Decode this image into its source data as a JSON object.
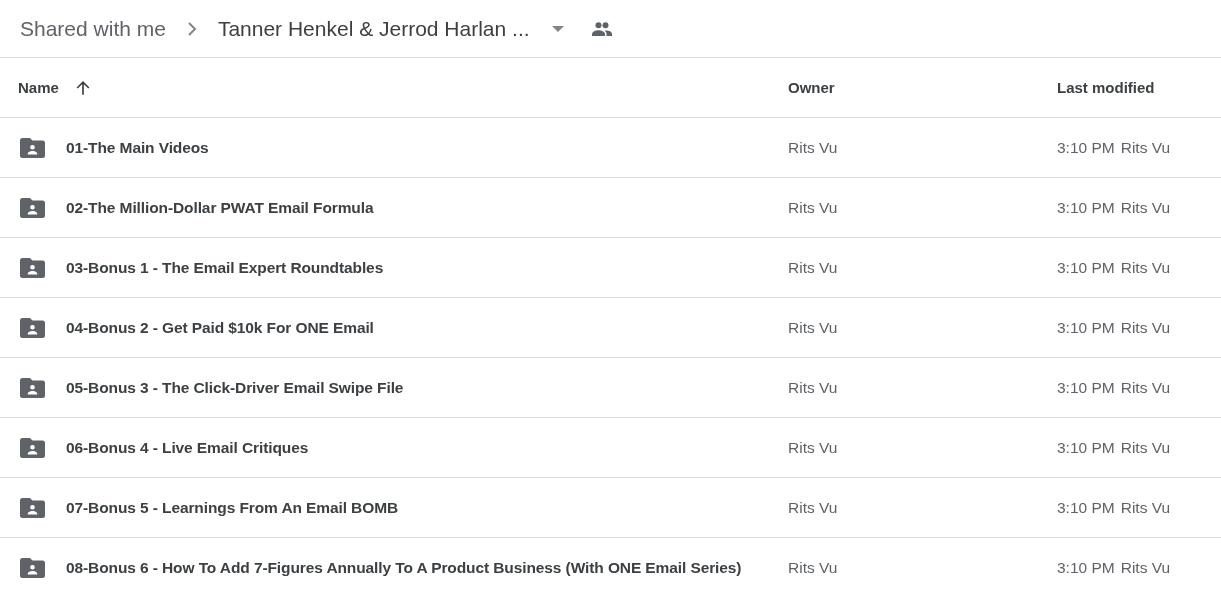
{
  "breadcrumb": [
    {
      "label": "Shared with me",
      "current": false
    },
    {
      "label": "Tanner Henkel & Jerrod Harlan ...",
      "current": true
    }
  ],
  "table": {
    "columns": [
      {
        "label": "Name",
        "sorted": true
      },
      {
        "label": "Owner"
      },
      {
        "label": "Last modified"
      }
    ],
    "rows": [
      {
        "name": "01-The Main Videos",
        "owner": "Rits Vu",
        "modified_time": "3:10 PM",
        "modified_by": "Rits Vu"
      },
      {
        "name": "02-The Million-Dollar PWAT Email Formula",
        "owner": "Rits Vu",
        "modified_time": "3:10 PM",
        "modified_by": "Rits Vu"
      },
      {
        "name": "03-Bonus 1 - The Email Expert Roundtables",
        "owner": "Rits Vu",
        "modified_time": "3:10 PM",
        "modified_by": "Rits Vu"
      },
      {
        "name": "04-Bonus 2 - Get Paid $10k For ONE Email",
        "owner": "Rits Vu",
        "modified_time": "3:10 PM",
        "modified_by": "Rits Vu"
      },
      {
        "name": "05-Bonus 3 - The Click-Driver Email Swipe File",
        "owner": "Rits Vu",
        "modified_time": "3:10 PM",
        "modified_by": "Rits Vu"
      },
      {
        "name": "06-Bonus 4 - Live Email Critiques",
        "owner": "Rits Vu",
        "modified_time": "3:10 PM",
        "modified_by": "Rits Vu"
      },
      {
        "name": "07-Bonus 5 - Learnings From An Email BOMB",
        "owner": "Rits Vu",
        "modified_time": "3:10 PM",
        "modified_by": "Rits Vu"
      },
      {
        "name": "08-Bonus 6 - How To Add 7-Figures Annually To A Product Business (With ONE Email Series)",
        "owner": "Rits Vu",
        "modified_time": "3:10 PM",
        "modified_by": "Rits Vu"
      }
    ]
  }
}
